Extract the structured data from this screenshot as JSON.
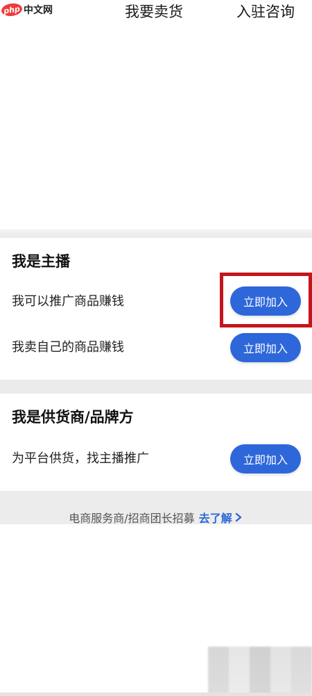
{
  "watermark": {
    "badge": "php",
    "text": "中文网"
  },
  "topnav": {
    "tabs": [
      {
        "label": "我要卖货"
      },
      {
        "label": "入驻咨询"
      }
    ]
  },
  "anchor_card": {
    "title": "我是主播",
    "rows": [
      {
        "text": "我可以推广商品赚钱",
        "button": "立即加入"
      },
      {
        "text": "我卖自己的商品赚钱",
        "button": "立即加入"
      }
    ]
  },
  "supplier_card": {
    "title": "我是供货商/品牌方",
    "rows": [
      {
        "text": "为平台供货，找主播推广",
        "button": "立即加入"
      }
    ]
  },
  "footer": {
    "text": "电商服务商/招商团长招募",
    "link": "去了解"
  },
  "colors": {
    "accent": "#2e67d9",
    "highlight": "#c4161c"
  }
}
